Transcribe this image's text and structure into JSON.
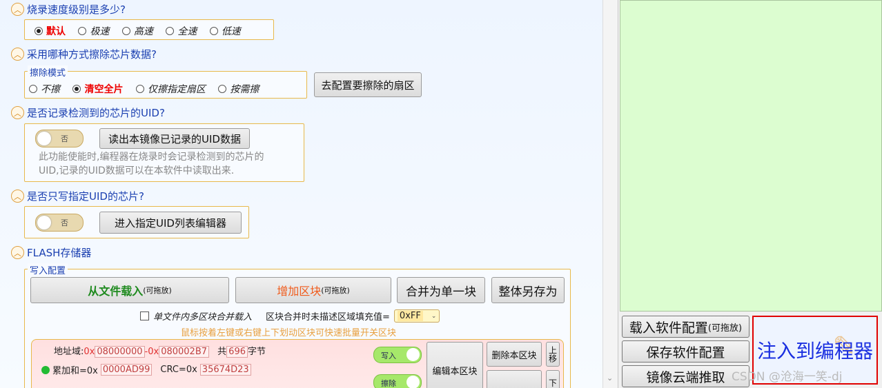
{
  "sections": {
    "speed": {
      "title": "烧录速度级别是多少?",
      "options": [
        "默认",
        "极速",
        "高速",
        "全速",
        "低速"
      ]
    },
    "erase": {
      "title": "采用哪种方式擦除芯片数据?",
      "legend": "擦除模式",
      "options": [
        "不擦",
        "清空全片",
        "仅擦指定扇区",
        "按需擦"
      ],
      "config_button": "去配置要擦除的扇区"
    },
    "uid_record": {
      "title": "是否记录检测到的芯片的UID?",
      "toggle_label": "否",
      "read_button": "读出本镜像已记录的UID数据",
      "desc_line1": "此功能使能时,编程器在烧录时会记录检测到的芯片的",
      "desc_line2": "UID,记录的UID数据可以在本软件中读取出来."
    },
    "uid_only": {
      "title": "是否只写指定UID的芯片?",
      "toggle_label": "否",
      "edit_button": "进入指定UID列表编辑器"
    },
    "flash": {
      "title": "FLASH存储器",
      "legend": "写入配置",
      "load_button": "从文件载入",
      "load_hint": "(可拖放)",
      "add_button": "增加区块",
      "add_hint": "(可拖放)",
      "merge_button": "合并为单一块",
      "save_button": "整体另存为",
      "checkbox_label": "单文件内多区块合并载入",
      "fill_label": "区块合并时未描述区域填充值=",
      "fill_value": "0xFF",
      "hint": "鼠标按着左键或右键上下划动区块可快速批量开关区块",
      "block": {
        "addr_label": "地址域:",
        "addr_prefix": "0x",
        "addr_start": "08000000",
        "addr_sep": "-0x",
        "addr_end": "080002B7",
        "total_label": "共",
        "total_bytes": "696",
        "bytes_unit": "字节",
        "sum_label": "累加和=0x",
        "sum_value": "0000AD99",
        "crc_label": "CRC=0x",
        "crc_value": "35674D23",
        "write_toggle": "写入",
        "erase_toggle": "擦除",
        "edit_button": "编辑本区块",
        "delete_button": "删除本区块",
        "up_button": "上移",
        "down_button": "下"
      }
    }
  },
  "right": {
    "load_config": "载入软件配置",
    "load_config_hint": "(可拖放)",
    "save_config": "保存软件配置",
    "cloud_push": "镜像云端推取",
    "inject": "注入到编程器",
    "watermark": "CSDN @沧海一笑-dj"
  }
}
